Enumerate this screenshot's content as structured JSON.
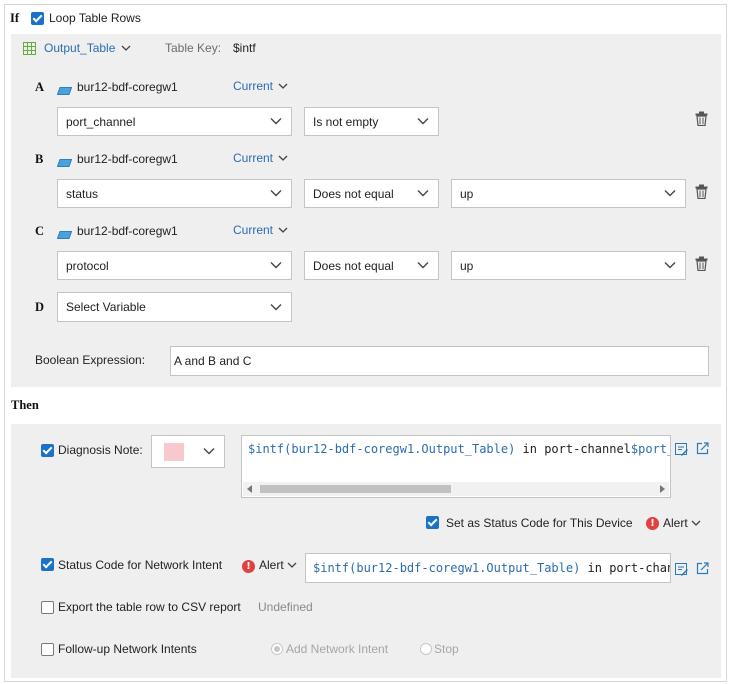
{
  "if_section": {
    "label": "If",
    "loop_checkbox": {
      "label": "Loop Table Rows",
      "checked": true
    },
    "table": {
      "name": "Output_Table",
      "key_label": "Table Key:",
      "key_value": "$intf"
    }
  },
  "conditions": [
    {
      "letter": "A",
      "device": "bur12-bdf-coregw1",
      "scope": "Current",
      "variable": "port_channel",
      "operator": "Is not empty",
      "value": null
    },
    {
      "letter": "B",
      "device": "bur12-bdf-coregw1",
      "scope": "Current",
      "variable": "status",
      "operator": "Does not equal",
      "value": "up"
    },
    {
      "letter": "C",
      "device": "bur12-bdf-coregw1",
      "scope": "Current",
      "variable": "protocol",
      "operator": "Does not equal",
      "value": "up"
    },
    {
      "letter": "D",
      "variable_placeholder": "Select Variable"
    }
  ],
  "boolean_expression": {
    "label": "Boolean Expression:",
    "value": "A and B and C"
  },
  "then_section": {
    "label": "Then",
    "diagnosis_note": {
      "label": "Diagnosis Note:",
      "checked": true,
      "color": "#f8c8cf",
      "text_var": "$intf(bur12-bdf-coregw1.Output_Table)",
      "text_mid": " in port-channel",
      "text_tail": "$port_"
    },
    "status_code_device": {
      "label": "Set as Status Code for This Device",
      "checked": true,
      "level": "Alert"
    },
    "status_code_intent": {
      "label": "Status Code for Network Intent",
      "checked": true,
      "level": "Alert",
      "text_var": "$intf(bur12-bdf-coregw1.Output_Table)",
      "text_mid": " in port-chan"
    },
    "export_csv": {
      "label": "Export the table row to CSV report",
      "checked": false,
      "status": "Undefined"
    },
    "follow_up": {
      "label": "Follow-up Network Intents",
      "checked": false,
      "option_add": "Add Network Intent",
      "option_stop": "Stop"
    }
  },
  "colors": {
    "accent": "#1a73c8",
    "link": "#2b6cb0",
    "alert": "#e04141",
    "panel": "#efefef"
  },
  "icons": [
    "table-icon",
    "device-icon",
    "trash-icon",
    "edit-icon",
    "external-link-icon",
    "alert-icon",
    "chevron-down-icon"
  ]
}
